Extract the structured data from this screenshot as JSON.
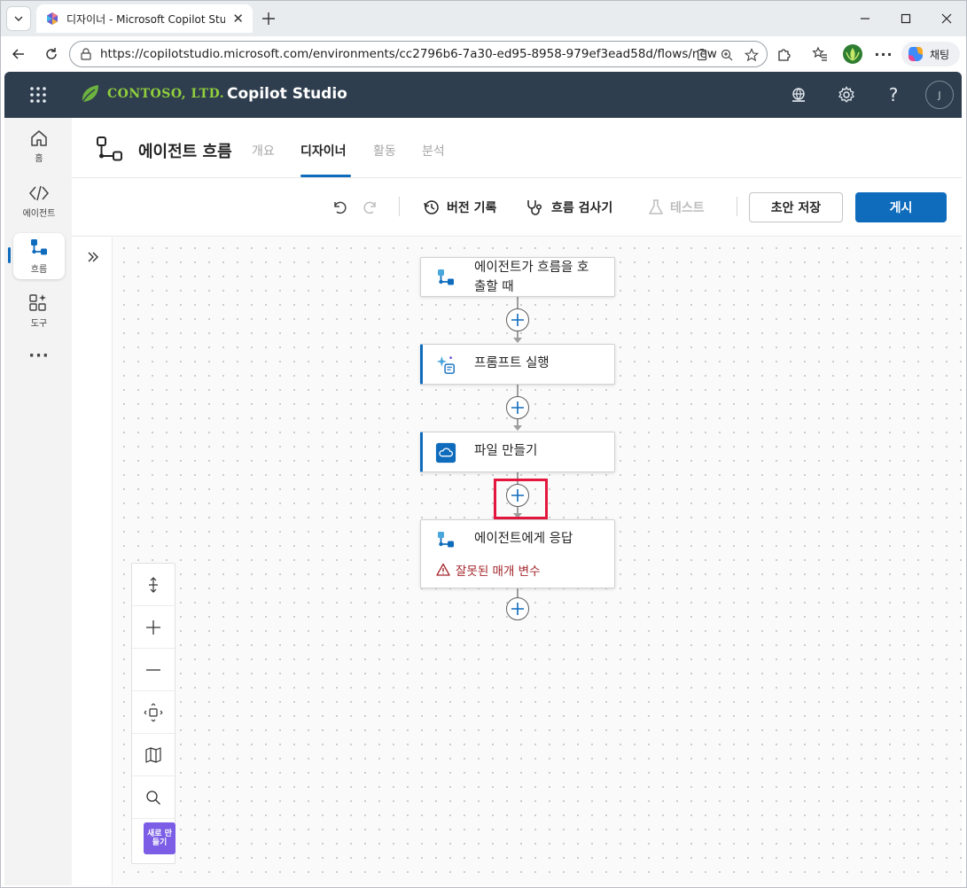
{
  "browser": {
    "tab_title": "디자이너 - Microsoft Copilot Studio",
    "url": "https://copilotstudio.microsoft.com/environments/cc2796b6-7a30-ed95-8958-979ef3ead58d/flows/new",
    "chat_label": "채팅"
  },
  "header": {
    "org_name": "CONTOSO, LTD.",
    "app_name": "Copilot Studio",
    "avatar_initial": "J"
  },
  "rail": {
    "items": [
      {
        "label": "홈",
        "icon": "home-icon"
      },
      {
        "label": "에이전트",
        "icon": "agent-code-icon"
      },
      {
        "label": "흐름",
        "icon": "flow-icon"
      },
      {
        "label": "도구",
        "icon": "tools-icon"
      }
    ],
    "more": "···"
  },
  "page": {
    "title": "에이전트 흐름",
    "tabs": [
      {
        "label": "개요",
        "active": false
      },
      {
        "label": "디자이너",
        "active": true
      },
      {
        "label": "활동",
        "active": false
      },
      {
        "label": "분석",
        "active": false
      }
    ]
  },
  "commands": {
    "version_history": "버전 기록",
    "flow_checker": "흐름 검사기",
    "test": "테스트",
    "save_draft": "초안 저장",
    "publish": "게시"
  },
  "flow": {
    "nodes": [
      {
        "label": "에이전트가 흐름을 호출할 때",
        "label_line1": "에이전트가 흐름을 호",
        "label_line2": "출할 때",
        "icon": "agent-flow-icon"
      },
      {
        "label": "프롬프트 실행",
        "icon": "prompt-sparkle-icon"
      },
      {
        "label": "파일 만들기",
        "icon": "onedrive-cloud-icon"
      },
      {
        "label": "에이전트에게 응답",
        "icon": "agent-flow-icon",
        "error": "잘못된 매개 변수"
      }
    ]
  },
  "zoom": {
    "new_badge": "새로 만들기"
  },
  "colors": {
    "header_bg": "#2f3e4e",
    "accent": "#0f6cbd",
    "logo_green": "#8fcf3d",
    "error": "#a4262c",
    "highlight": "#e3173e"
  }
}
